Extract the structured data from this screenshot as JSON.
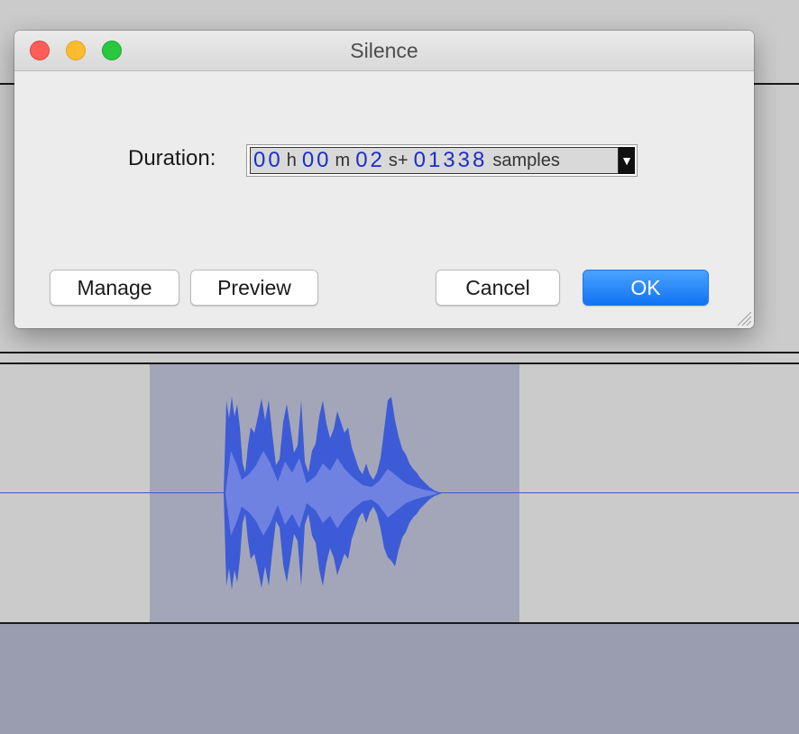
{
  "dialog": {
    "title": "Silence",
    "duration_label": "Duration:",
    "duration": {
      "hours": "00",
      "hours_unit": "h",
      "minutes": "00",
      "minutes_unit": "m",
      "seconds": "02",
      "seconds_unit": "s+",
      "samples": "01338",
      "samples_unit": "samples"
    },
    "buttons": {
      "manage": "Manage",
      "preview": "Preview",
      "cancel": "Cancel",
      "ok": "OK"
    }
  },
  "colors": {
    "waveform": "#3d5bd6",
    "selection": "#a3a6b9",
    "accent": "#1c7cf7"
  },
  "icons": [
    "close-icon",
    "minimize-icon",
    "zoom-icon",
    "dropdown-arrow-icon",
    "resize-grip-icon"
  ]
}
